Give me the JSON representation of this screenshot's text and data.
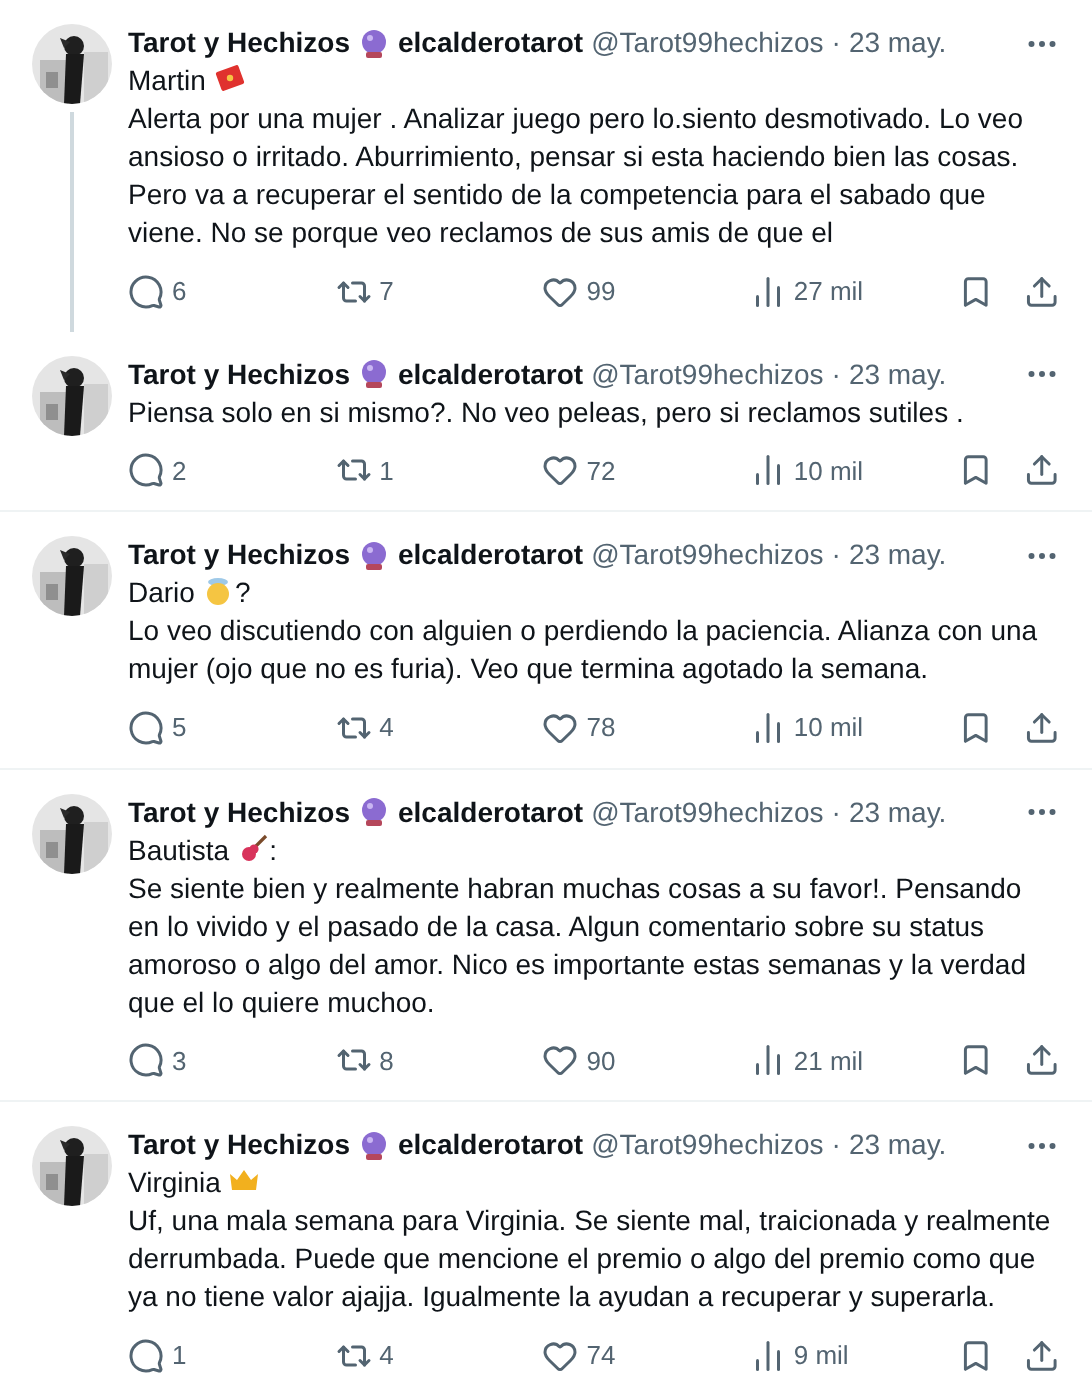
{
  "tweets": [
    {
      "author": "Tarot y Hechizos",
      "author_2": "elcalderotarot",
      "handle": "@Tarot99hechizos",
      "separator": "·",
      "date": "23 may.",
      "title": "Martin",
      "title_icon": {
        "kind": "envelope"
      },
      "body": "Alerta por una mujer . Analizar juego pero lo.siento desmotivado. Lo veo ansioso o irritado. Aburrimiento, pensar si esta haciendo bien las cosas. Pero va a recuperar el sentido de la competencia para el sabado que viene. No se porque veo reclamos de sus amis de que el",
      "thread_continues": true,
      "stats": {
        "replies": "6",
        "reposts": "7",
        "likes": "99",
        "views": "27 mil"
      }
    },
    {
      "author": "Tarot y Hechizos",
      "author_2": "elcalderotarot",
      "handle": "@Tarot99hechizos",
      "separator": "·",
      "date": "23 may.",
      "body": "Piensa solo en si mismo?. No veo peleas, pero si reclamos sutiles .",
      "thread_continues": false,
      "stats": {
        "replies": "2",
        "reposts": "1",
        "likes": "72",
        "views": "10 mil"
      }
    },
    {
      "author": "Tarot y Hechizos",
      "author_2": "elcalderotarot",
      "handle": "@Tarot99hechizos",
      "separator": "·",
      "date": "23 may.",
      "title": "Dario",
      "title_icon": {
        "kind": "face"
      },
      "title_suffix": "?",
      "body": "Lo veo discutiendo con alguien o perdiendo la paciencia. Alianza con una mujer (ojo que no es furia). Veo que termina agotado la semana.",
      "thread_continues": false,
      "stats": {
        "replies": "5",
        "reposts": "4",
        "likes": "78",
        "views": "10 mil"
      }
    },
    {
      "author": "Tarot y Hechizos",
      "author_2": "elcalderotarot",
      "handle": "@Tarot99hechizos",
      "separator": "·",
      "date": "23 may.",
      "title": "Bautista",
      "title_icon": {
        "kind": "guitar"
      },
      "title_suffix": ":",
      "body": "Se siente bien y realmente habran muchas cosas a su favor!. Pensando en lo vivido y el pasado de la casa. Algun comentario sobre su status amoroso o algo del amor. Nico es importante estas semanas y la verdad que el lo quiere muchoo.",
      "thread_continues": false,
      "stats": {
        "replies": "3",
        "reposts": "8",
        "likes": "90",
        "views": "21 mil"
      }
    },
    {
      "author": "Tarot y Hechizos",
      "author_2": "elcalderotarot",
      "handle": "@Tarot99hechizos",
      "separator": "·",
      "date": "23 may.",
      "title": "Virginia",
      "title_icon": {
        "kind": "crown"
      },
      "body": "Uf, una mala semana para Virginia. Se siente mal, traicionada y realmente derrumbada. Puede que mencione el premio o algo del premio como que ya no tiene valor ajajja. Igualmente la ayudan a recuperar y superarla.",
      "thread_continues": false,
      "stats": {
        "replies": "1",
        "reposts": "4",
        "likes": "74",
        "views": "9 mil"
      }
    }
  ]
}
